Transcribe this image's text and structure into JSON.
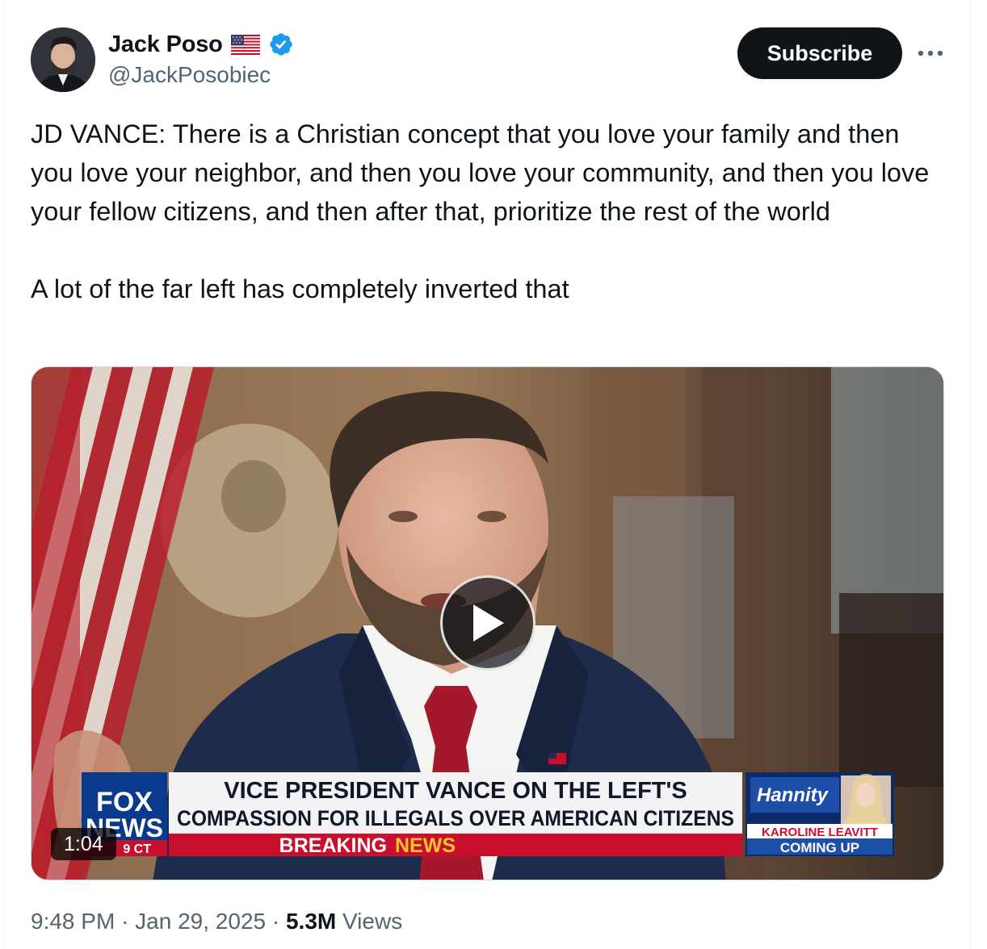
{
  "author": {
    "name": "Jack Poso",
    "handle": "@JackPosobiec",
    "flag_icon": "us-flag-icon",
    "verified_icon": "verified-badge-icon",
    "verified_color": "#1d9bf0"
  },
  "actions": {
    "subscribe_label": "Subscribe",
    "more_icon": "more-horizontal-icon"
  },
  "tweet": {
    "paragraph1": "JD VANCE: There is a Christian concept that you love your family and then you love your neighbor, and then you love your community, and then you love your fellow citizens, and then after that, prioritize the rest of the world",
    "paragraph2": "A lot of the far left has completely inverted that"
  },
  "video": {
    "duration": "1:04",
    "play_icon": "play-icon",
    "chyron": {
      "network_line1": "FOX",
      "network_line2": "NEWS",
      "time_fragment": "9 CT",
      "headline_line1": "VICE PRESIDENT VANCE ON THE LEFT'S",
      "headline_line2": "COMPASSION FOR ILLEGALS OVER AMERICAN CITIZENS",
      "breaking": "BREAKING",
      "news": "NEWS",
      "show_name": "Hannity",
      "upcoming_guest": "KAROLINE LEAVITT",
      "coming_up": "COMING UP"
    }
  },
  "meta": {
    "time": "9:48 PM",
    "sep1": "·",
    "date": "Jan 29, 2025",
    "sep2": "·",
    "views_count": "5.3M",
    "views_label": "Views"
  },
  "colors": {
    "text_primary": "#0f1419",
    "text_secondary": "#536471",
    "breaking_red": "#c8102e",
    "fox_blue": "#0a3a8c"
  }
}
